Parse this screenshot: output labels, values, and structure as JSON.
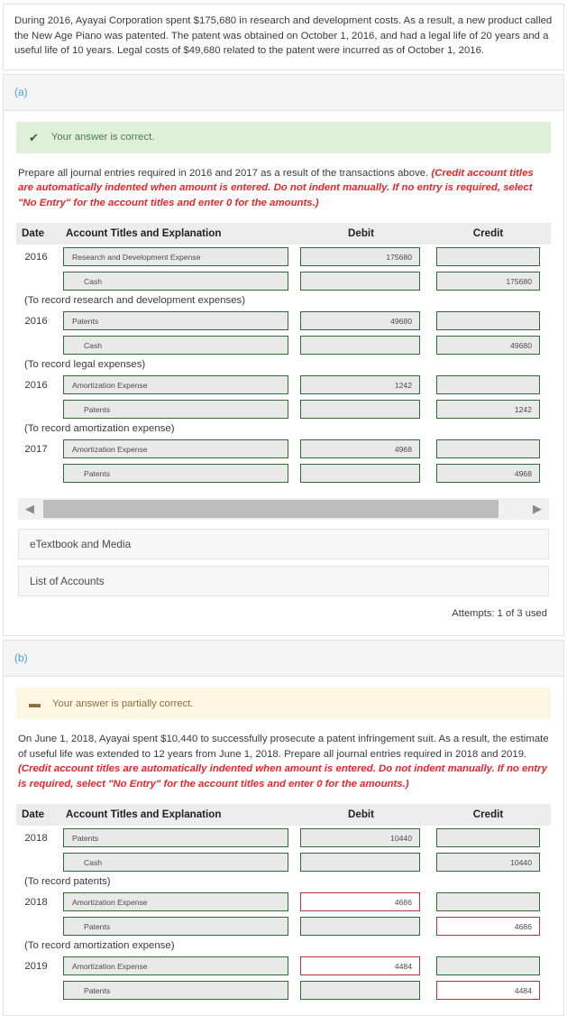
{
  "intro": {
    "text": "During 2016, Ayayai Corporation spent $175,680 in research and development costs. As a result, a new product called the New Age Piano was patented. The patent was obtained on October 1, 2016, and had a legal life of 20 years and a useful life of 10 years. Legal costs of $49,680 related to the patent were incurred as of October 1, 2016."
  },
  "colors": {
    "accent_blue": "#4aa3df",
    "correct_green": "#2f6b33",
    "wrong_red": "#b9313a",
    "hint_red": "#e8252a",
    "alert_correct_bg": "#dff0d8",
    "alert_partial_bg": "#fcf6e3"
  },
  "table_headers": {
    "date": "Date",
    "account": "Account Titles and Explanation",
    "debit": "Debit",
    "credit": "Credit"
  },
  "part_a": {
    "label": "(a)",
    "alert": {
      "icon": "check-icon",
      "glyph": "✔",
      "text": "Your answer is correct."
    },
    "instructions_main": "Prepare all journal entries required in 2016 and 2017 as a result of the transactions above. ",
    "instructions_hint": "(Credit account titles are automatically indented when amount is entered. Do not indent manually. If no entry is required, select \"No Entry\" for the account titles and enter 0 for the amounts.)",
    "rows": [
      {
        "type": "entry",
        "date": "2016",
        "account": "Research and Development Expense",
        "indent": false,
        "debit": "175680",
        "credit": "",
        "account_state": "correct",
        "debit_state": "correct",
        "credit_state": "correct"
      },
      {
        "type": "entry",
        "date": "",
        "account": "Cash",
        "indent": true,
        "debit": "",
        "credit": "175680",
        "account_state": "correct",
        "debit_state": "correct",
        "credit_state": "correct"
      },
      {
        "type": "explain",
        "text": "(To record research and development expenses)"
      },
      {
        "type": "entry",
        "date": "2016",
        "account": "Patents",
        "indent": false,
        "debit": "49680",
        "credit": "",
        "account_state": "correct",
        "debit_state": "correct",
        "credit_state": "correct"
      },
      {
        "type": "entry",
        "date": "",
        "account": "Cash",
        "indent": true,
        "debit": "",
        "credit": "49680",
        "account_state": "correct",
        "debit_state": "correct",
        "credit_state": "correct"
      },
      {
        "type": "explain",
        "text": "(To record legal expenses)"
      },
      {
        "type": "entry",
        "date": "2016",
        "account": "Amortization Expense",
        "indent": false,
        "debit": "1242",
        "credit": "",
        "account_state": "correct",
        "debit_state": "correct",
        "credit_state": "correct"
      },
      {
        "type": "entry",
        "date": "",
        "account": "Patents",
        "indent": true,
        "debit": "",
        "credit": "1242",
        "account_state": "correct",
        "debit_state": "correct",
        "credit_state": "correct"
      },
      {
        "type": "explain",
        "text": "(To record amortization expense)"
      },
      {
        "type": "entry",
        "date": "2017",
        "account": "Amortization Expense",
        "indent": false,
        "debit": "4968",
        "credit": "",
        "account_state": "correct",
        "debit_state": "correct",
        "credit_state": "correct"
      },
      {
        "type": "entry",
        "date": "",
        "account": "Patents",
        "indent": true,
        "debit": "",
        "credit": "4968",
        "account_state": "correct",
        "debit_state": "correct",
        "credit_state": "correct"
      }
    ],
    "scroll": {
      "left_arrow": "◀",
      "right_arrow": "▶"
    },
    "etextbook_label": "eTextbook and Media",
    "list_of_accounts_label": "List of Accounts",
    "attempts": "Attempts: 1 of 3 used"
  },
  "part_b": {
    "label": "(b)",
    "alert": {
      "icon": "dash-icon",
      "glyph": "➖",
      "text": "Your answer is partially correct."
    },
    "instructions_main": "On June 1, 2018, Ayayai spent $10,440 to successfully prosecute a patent infringement suit. As a result, the estimate of useful life was extended to 12 years from June 1, 2018. Prepare all journal entries required in 2018 and 2019. ",
    "instructions_hint": "(Credit account titles are automatically indented when amount is entered. Do not indent manually. If no entry is required, select \"No Entry\" for the account titles and enter 0 for the amounts.)",
    "rows": [
      {
        "type": "entry",
        "date": "2018",
        "account": "Patents",
        "indent": false,
        "debit": "10440",
        "credit": "",
        "account_state": "correct",
        "debit_state": "correct",
        "credit_state": "correct"
      },
      {
        "type": "entry",
        "date": "",
        "account": "Cash",
        "indent": true,
        "debit": "",
        "credit": "10440",
        "account_state": "correct",
        "debit_state": "correct",
        "credit_state": "correct"
      },
      {
        "type": "explain",
        "text": "(To record patents)"
      },
      {
        "type": "entry",
        "date": "2018",
        "account": "Amortization Expense",
        "indent": false,
        "debit": "4686",
        "credit": "",
        "account_state": "correct",
        "debit_state": "wrong",
        "credit_state": "correct"
      },
      {
        "type": "entry",
        "date": "",
        "account": "Patents",
        "indent": true,
        "debit": "",
        "credit": "4686",
        "account_state": "correct",
        "debit_state": "correct",
        "credit_state": "wrong"
      },
      {
        "type": "explain",
        "text": "(To record amortization expense)"
      },
      {
        "type": "entry",
        "date": "2019",
        "account": "Amortization Expense",
        "indent": false,
        "debit": "4484",
        "credit": "",
        "account_state": "correct",
        "debit_state": "wrong",
        "credit_state": "correct"
      },
      {
        "type": "entry",
        "date": "",
        "account": "Patents",
        "indent": true,
        "debit": "",
        "credit": "4484",
        "account_state": "correct",
        "debit_state": "correct",
        "credit_state": "wrong"
      }
    ]
  }
}
